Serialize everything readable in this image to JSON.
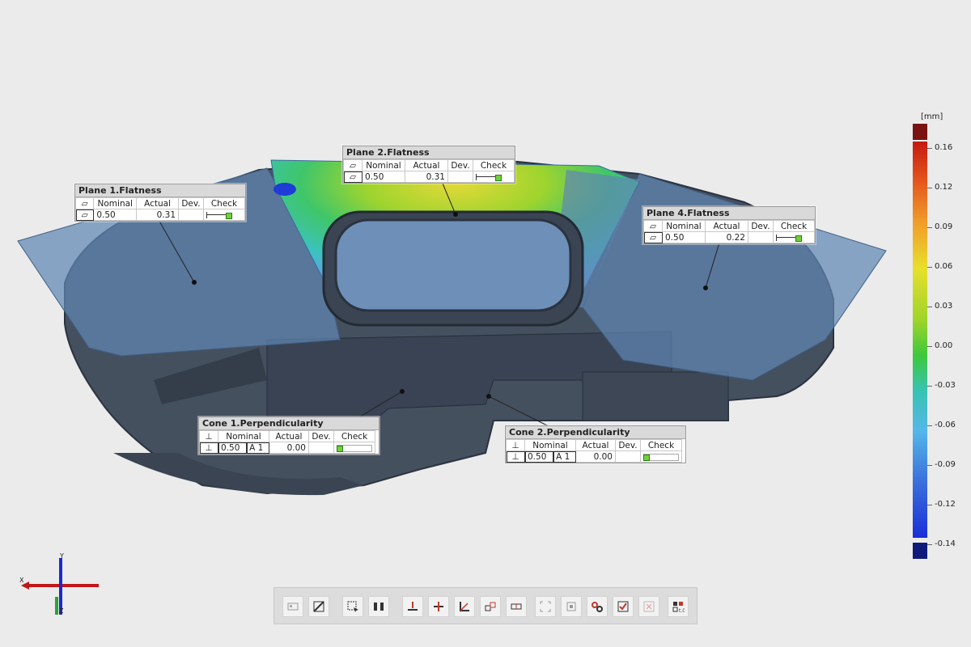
{
  "callouts": {
    "plane1": {
      "title": "Plane 1.Flatness",
      "headers": [
        "Nominal",
        "Actual",
        "Dev.",
        "Check"
      ],
      "symbol": "▱",
      "nominal": "0.50",
      "actual": "0.31",
      "dev": ""
    },
    "plane2": {
      "title": "Plane 2.Flatness",
      "headers": [
        "Nominal",
        "Actual",
        "Dev.",
        "Check"
      ],
      "symbol": "▱",
      "nominal": "0.50",
      "actual": "0.31",
      "dev": ""
    },
    "plane4": {
      "title": "Plane 4.Flatness",
      "headers": [
        "Nominal",
        "Actual",
        "Dev.",
        "Check"
      ],
      "symbol": "▱",
      "nominal": "0.50",
      "actual": "0.22",
      "dev": ""
    },
    "cone1": {
      "title": "Cone 1.Perpendicularity",
      "headers": [
        "Nominal",
        "Actual",
        "Dev.",
        "Check"
      ],
      "symbol": "⊥",
      "nominal": "0.50",
      "datum": "A 1",
      "actual": "0.00",
      "dev": ""
    },
    "cone2": {
      "title": "Cone 2.Perpendicularity",
      "headers": [
        "Nominal",
        "Actual",
        "Dev.",
        "Check"
      ],
      "symbol": "⊥",
      "nominal": "0.50",
      "datum": "A 1",
      "actual": "0.00",
      "dev": ""
    }
  },
  "legend": {
    "unit": "[mm]",
    "labels": [
      "0.16",
      "0.12",
      "0.09",
      "0.06",
      "0.03",
      "0.00",
      "-0.03",
      "-0.06",
      "-0.09",
      "-0.12",
      "-0.14"
    ],
    "top_color": "#7a1212",
    "bottom_color": "#101a7a"
  },
  "axes": {
    "x": "X",
    "y": "Y",
    "z": "Z"
  },
  "toolbar": {
    "icons": [
      "view-mode-icon",
      "section-icon",
      "select-region-icon",
      "split-icon",
      "align-icon",
      "distribute-icon",
      "angle-icon",
      "geometry-icon",
      "label-icon",
      "fit-icon",
      "zoom-extent-icon",
      "connect-icon",
      "check-icon",
      "close-icon",
      "settings-icon"
    ]
  },
  "colors": {
    "background": "#ebebeb",
    "part": "#4a5769",
    "plane": "#5f86b3"
  }
}
